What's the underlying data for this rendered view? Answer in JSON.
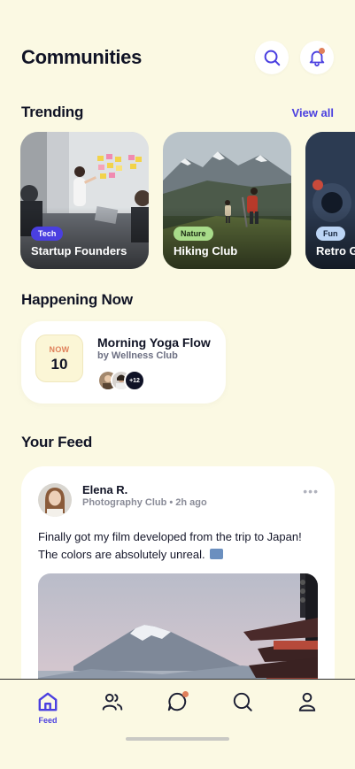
{
  "header": {
    "title": "Communities"
  },
  "trending": {
    "title": "Trending",
    "view_all": "View all",
    "cards": [
      {
        "tag": "Tech",
        "name": "Startup Founders"
      },
      {
        "tag": "Nature",
        "name": "Hiking Club"
      },
      {
        "tag": "Fun",
        "name": "Retro G"
      }
    ]
  },
  "happening": {
    "title": "Happening Now",
    "event": {
      "month": "NOW",
      "day": "10",
      "title": "Morning Yoga Flow",
      "host": "by Wellness Club",
      "more_count": "+12"
    }
  },
  "feed": {
    "title": "Your Feed",
    "post": {
      "author": "Elena R.",
      "meta": "Photography Club • 2h ago",
      "text": "Finally got my film developed from the trip to Japan! The colors are absolutely unreal."
    }
  },
  "nav": {
    "items": [
      {
        "icon": "home-icon",
        "label": "Feed",
        "active": true
      },
      {
        "icon": "people-icon",
        "label": "",
        "active": false
      },
      {
        "icon": "chat-icon",
        "label": "",
        "active": false
      },
      {
        "icon": "search-icon",
        "label": "",
        "active": false
      },
      {
        "icon": "profile-icon",
        "label": "",
        "active": false
      }
    ]
  },
  "colors": {
    "background": "#fbf9e3",
    "accent": "#4a3fe0",
    "notification": "#e0805a",
    "tag_tech": "#4a3fe0",
    "tag_nature": "#a8dc8a",
    "tag_fun": "#bcd5f5"
  }
}
